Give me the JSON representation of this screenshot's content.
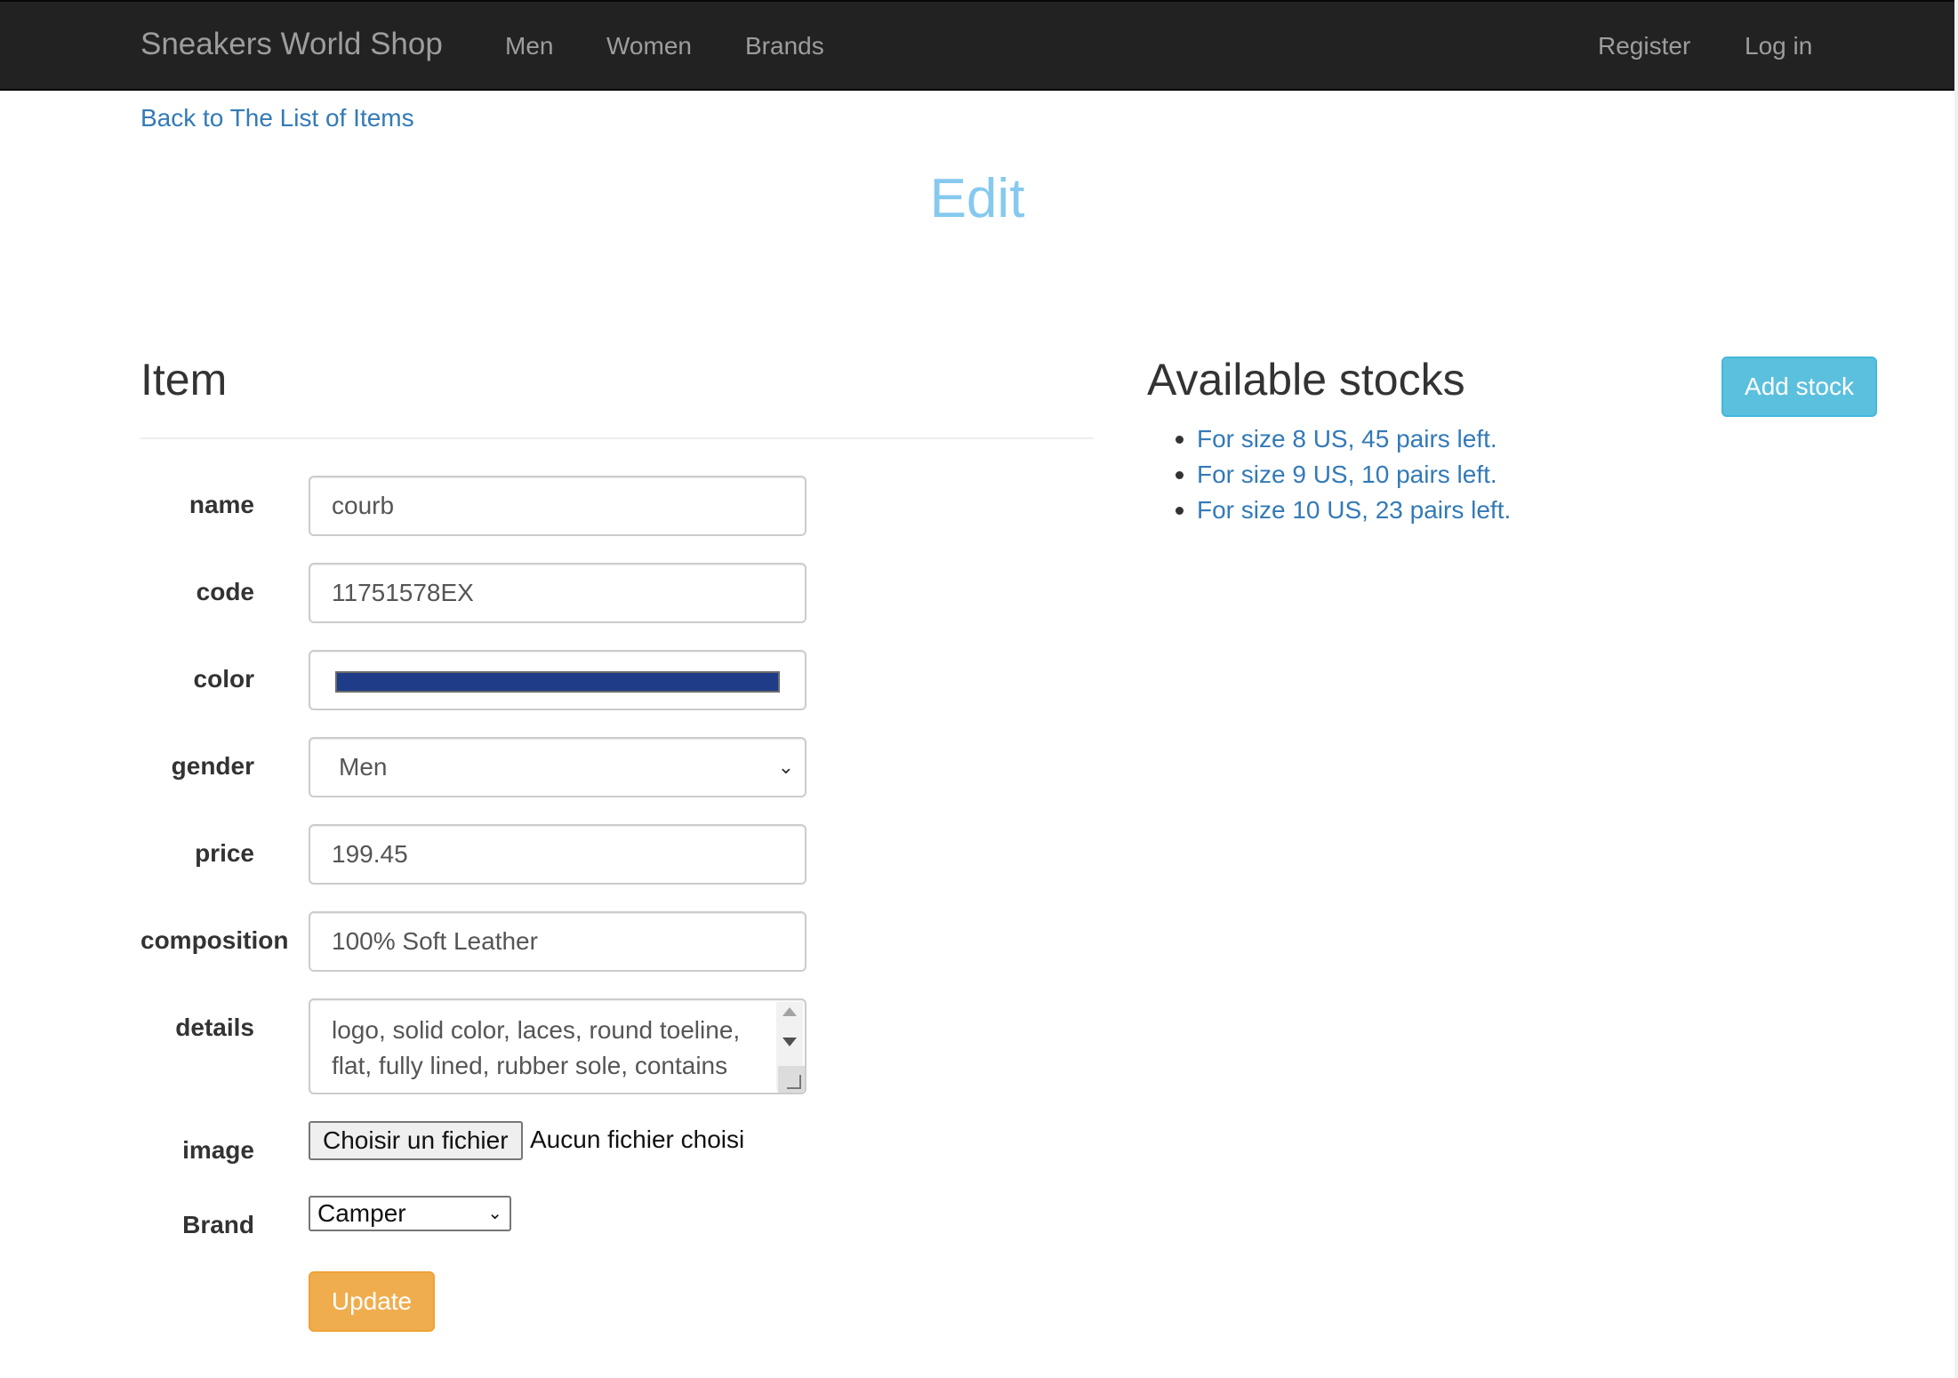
{
  "navbar": {
    "brand": "Sneakers World Shop",
    "links": [
      "Men",
      "Women",
      "Brands"
    ],
    "register": "Register",
    "login": "Log in"
  },
  "back_link": "Back to The List of Items",
  "page_title": "Edit",
  "item_section": {
    "heading": "Item",
    "fields": {
      "name": {
        "label": "name",
        "value": "courb"
      },
      "code": {
        "label": "code",
        "value": "11751578EX"
      },
      "color": {
        "label": "color",
        "value": "#1f3c88"
      },
      "gender": {
        "label": "gender",
        "value": "Men"
      },
      "price": {
        "label": "price",
        "value": "199.45"
      },
      "composition": {
        "label": "composition",
        "value": "100% Soft Leather"
      },
      "details": {
        "label": "details",
        "lines": [
          "logo, solid color, laces, round toeline,",
          "flat, fully lined, rubber sole, contains"
        ]
      },
      "image": {
        "label": "image",
        "button": "Choisir un fichier",
        "status": "Aucun fichier choisi"
      },
      "brand": {
        "label": "Brand",
        "value": "Camper"
      }
    },
    "update_button": "Update"
  },
  "stocks_section": {
    "heading": "Available stocks",
    "add_button": "Add stock",
    "items": [
      "For size 8 US, 45 pairs left.",
      "For size 9 US, 10 pairs left.",
      "For size 10 US, 23 pairs left."
    ]
  },
  "colors": {
    "navbar_bg": "#222222",
    "link": "#337ab7",
    "title": "#86c9ef",
    "update_button": "#f0ad4e",
    "add_stock_button": "#5bc0de"
  }
}
